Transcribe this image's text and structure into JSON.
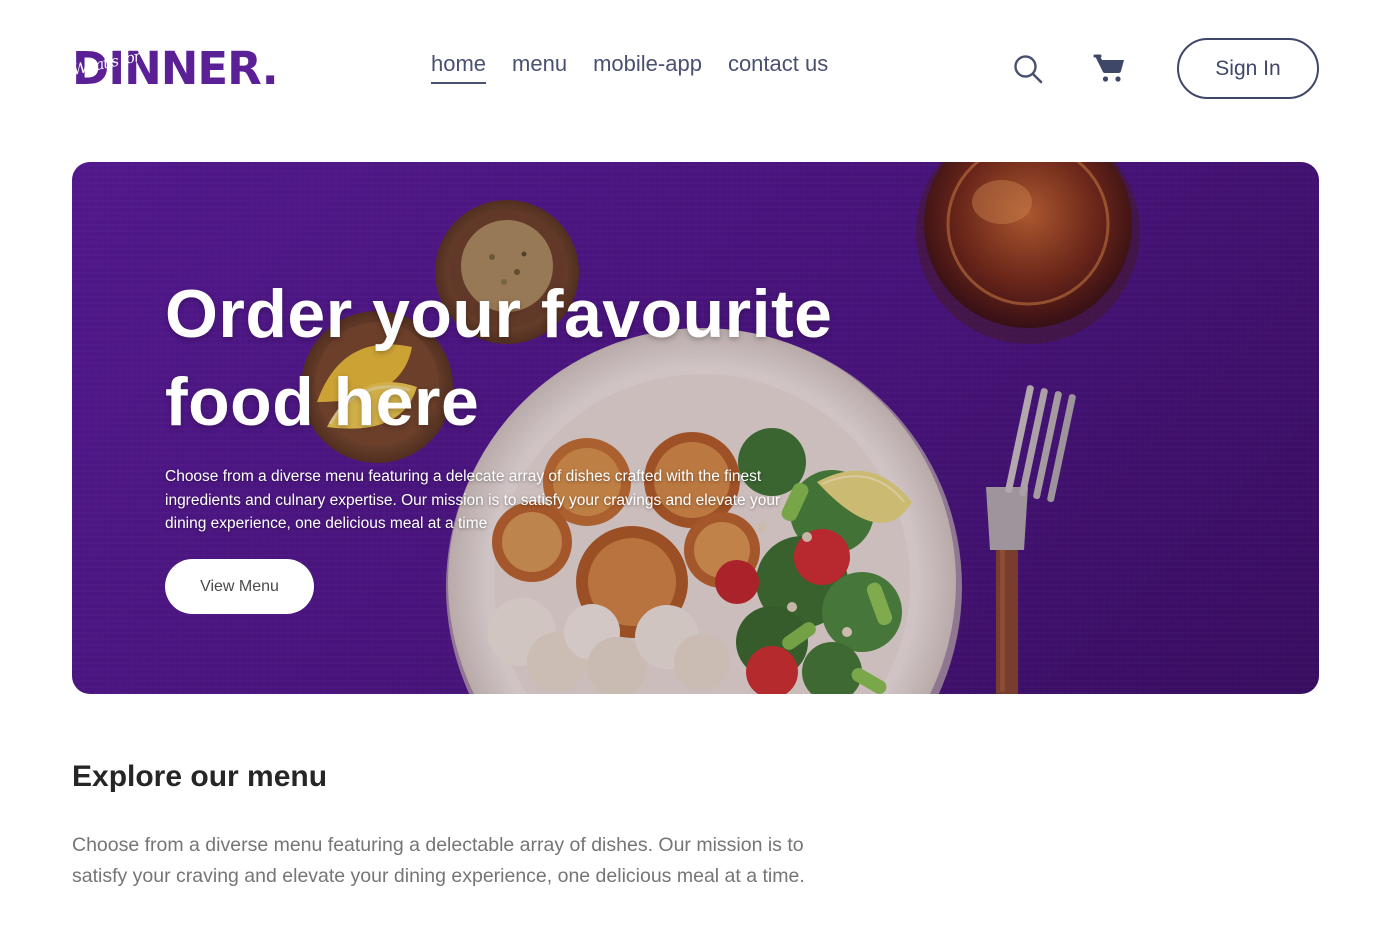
{
  "brand": {
    "logo_text": "DINNER.",
    "logo_script": "What's for",
    "logo_color": "#5b1f96"
  },
  "nav": {
    "items": [
      {
        "label": "home",
        "active": true
      },
      {
        "label": "menu",
        "active": false
      },
      {
        "label": "mobile-app",
        "active": false
      },
      {
        "label": "contact us",
        "active": false
      }
    ],
    "search_icon": "search-icon",
    "cart_icon": "cart-icon",
    "sign_in_label": "Sign In"
  },
  "hero": {
    "title": "Order your favourite food here",
    "description": "Choose from a diverse menu featuring a delecate array of dishes crafted with the finest ingredients and culnary expertise. Our mission is to satisfy your cravings and elevate your dining experience, one delicious meal at a time",
    "button_label": "View Menu",
    "background_color": "#55198f"
  },
  "explore": {
    "title": "Explore our menu",
    "description": "Choose from a diverse menu featuring a delectable array of dishes. Our mission is to satisfy your craving and elevate your dining experience, one delicious meal at a time."
  },
  "colors": {
    "nav_text": "#4a5170",
    "accent_purple": "#5b1f96",
    "muted_text": "#757575"
  }
}
